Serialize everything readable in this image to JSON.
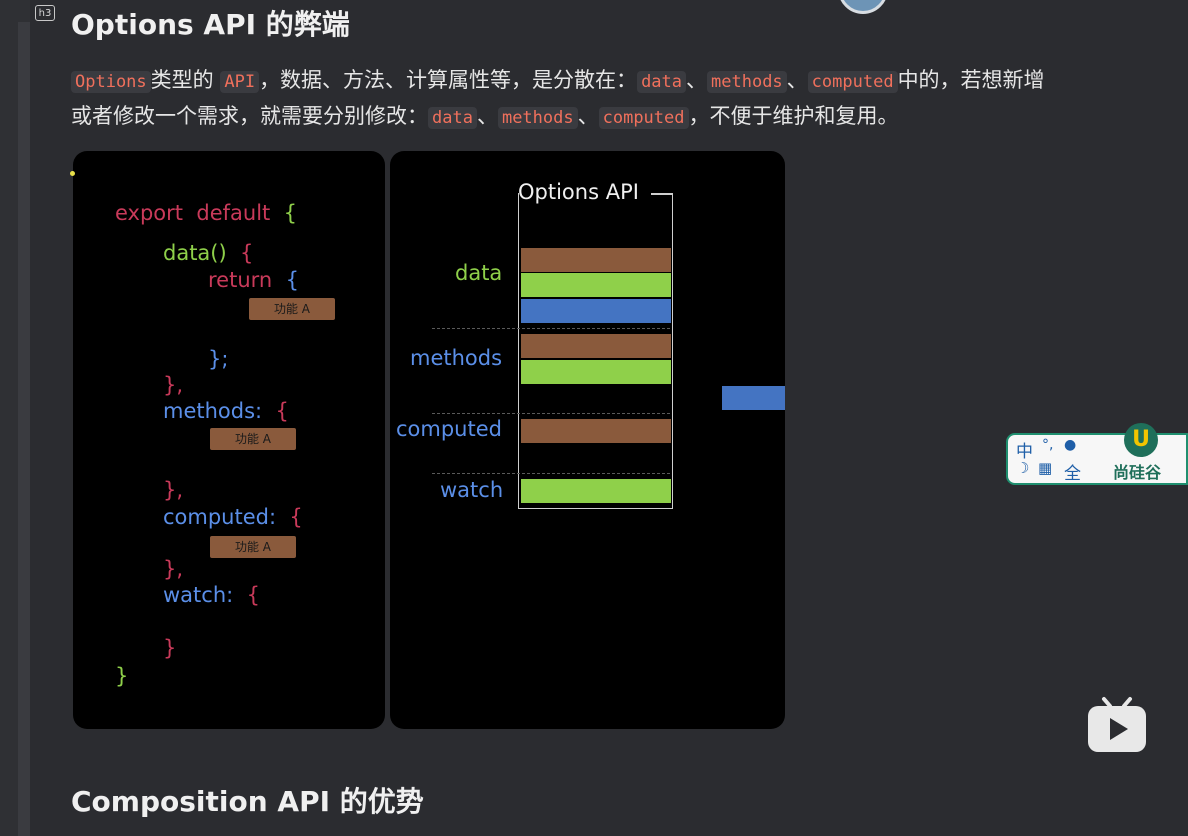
{
  "heading": {
    "tag": "h3",
    "title": "Options API 的弊端"
  },
  "paragraph": {
    "line1": [
      {
        "t": "code",
        "v": "Options"
      },
      {
        "t": "text",
        "v": "类型的 "
      },
      {
        "t": "code",
        "v": "API"
      },
      {
        "t": "text",
        "v": "，数据、方法、计算属性等，是分散在："
      },
      {
        "t": "code",
        "v": "data"
      },
      {
        "t": "text",
        "v": "、"
      },
      {
        "t": "code",
        "v": "methods"
      },
      {
        "t": "text",
        "v": "、"
      },
      {
        "t": "code",
        "v": "computed"
      },
      {
        "t": "text",
        "v": "中的，若想新增"
      }
    ],
    "line2": [
      {
        "t": "text",
        "v": "或者修改一个需求，就需要分别修改："
      },
      {
        "t": "code",
        "v": "data"
      },
      {
        "t": "text",
        "v": "、"
      },
      {
        "t": "code",
        "v": "methods"
      },
      {
        "t": "text",
        "v": "、"
      },
      {
        "t": "code",
        "v": "computed"
      },
      {
        "t": "text",
        "v": "，不便于维护和复用。"
      }
    ]
  },
  "code_panel": {
    "export": "export",
    "default": "default",
    "open_brace": "{",
    "data_fn": "data()",
    "return": "return",
    "feature_label": "功能 A",
    "close_return": "};",
    "close_comma": "},",
    "close_brace": "}",
    "methods": "methods:",
    "computed": "computed:",
    "watch": "watch:"
  },
  "options_panel": {
    "title": "Options API",
    "sections": {
      "data": "data",
      "methods": "methods",
      "computed": "computed",
      "watch": "watch"
    }
  },
  "ime": {
    "c1": "中",
    "c2": "°,",
    "c3": "☽",
    "c4": "▦",
    "c5": "全",
    "brand": "尚硅谷",
    "logo": "U"
  },
  "next_heading": "Composition API 的优势",
  "colors": {
    "brown": "#8a5a3c",
    "green": "#8fd04a",
    "blue": "#4474c2",
    "code_red": "#f0705c"
  },
  "icons": {
    "heading_tag": "h3-tag-icon",
    "video": "play-button-icon"
  }
}
